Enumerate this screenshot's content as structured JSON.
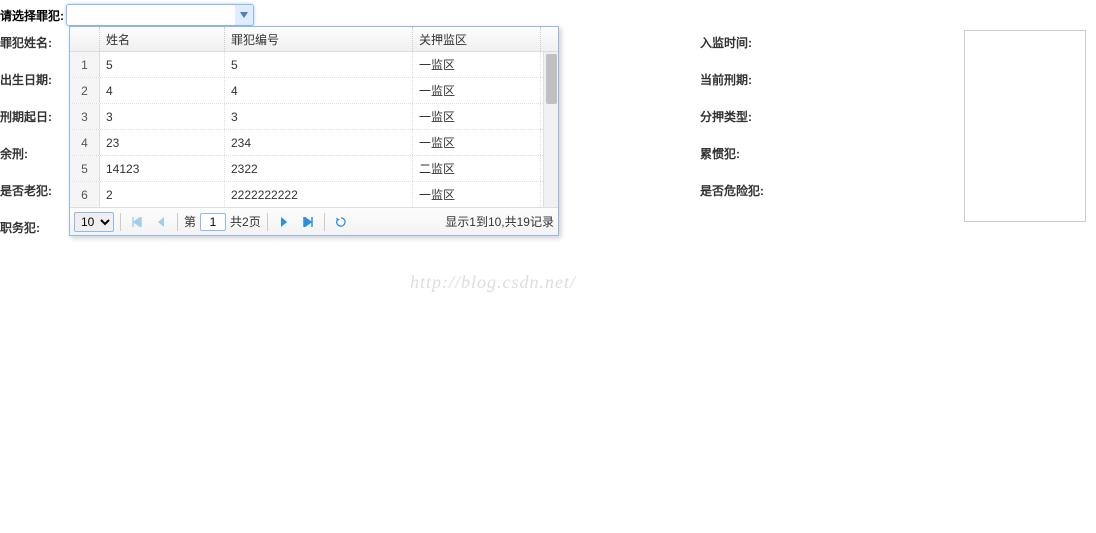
{
  "topLabel": "请选择罪犯:",
  "comboValue": "",
  "grid": {
    "headers": {
      "num": "",
      "name": "姓名",
      "code": "罪犯编号",
      "area": "关押监区"
    },
    "rows": [
      {
        "num": "1",
        "name": "5",
        "code": "5",
        "area": "一监区"
      },
      {
        "num": "2",
        "name": "4",
        "code": "4",
        "area": "一监区"
      },
      {
        "num": "3",
        "name": "3",
        "code": "3",
        "area": "一监区"
      },
      {
        "num": "4",
        "name": "23",
        "code": "234",
        "area": "一监区"
      },
      {
        "num": "5",
        "name": "14123",
        "code": "2322",
        "area": "二监区"
      },
      {
        "num": "6",
        "name": "2",
        "code": "2222222222",
        "area": "一监区"
      }
    ]
  },
  "pager": {
    "pageSize": "10",
    "pagePrefix": "第",
    "pageNum": "1",
    "pageTotal": "共2页",
    "info": "显示1到10,共19记录"
  },
  "leftFields": {
    "f1": "罪犯姓名:",
    "f2": "出生日期:",
    "f3": "刑期起日:",
    "f4": "余刑:",
    "f5": "是否老犯:",
    "f6": "职务犯:"
  },
  "rightFields": {
    "f1": "入监时间:",
    "f2": "当前刑期:",
    "f3": "分押类型:",
    "f4": "累惯犯:",
    "f5": "是否危险犯:"
  },
  "watermark": "http://blog.csdn.net/"
}
